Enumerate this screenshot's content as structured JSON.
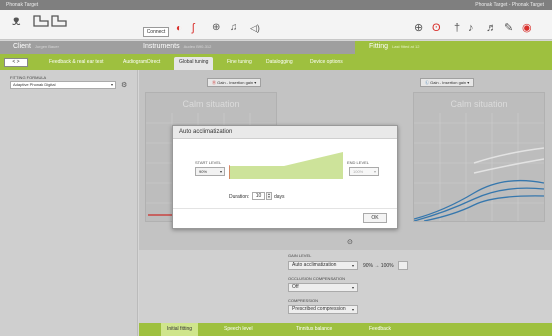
{
  "titlebar": {
    "app_name": "Phonak Target",
    "right_text": "Phonak Target - Phonak Target"
  },
  "toolbar": {
    "connect_label": "Connect",
    "icons": [
      "person-icon",
      "hearing-aids-icon",
      "ear-icon",
      "mic-icon",
      "speaker-icon",
      "globe-icon",
      "music-icon",
      "flag-icon",
      "dummy-icon",
      "tools-icon",
      "remote-icon"
    ]
  },
  "infobar": {
    "client_label": "Client",
    "client_sub": "Jurgen Bauer",
    "instruments_label": "Instruments",
    "instruments_sub": "Audeo B90-312",
    "fitting_label": "Fitting",
    "fitting_sub": "Last fitted at 12"
  },
  "tabs": {
    "nav_label": "< >",
    "items": [
      "Feedback & real ear test",
      "AudiogramDirect",
      "Global tuning",
      "Fine tuning",
      "Datalogging",
      "Device options"
    ],
    "active_index": 2
  },
  "left_panel": {
    "formula_label": "FITTING FORMULA",
    "formula_value": "Adaptive Phonak Digital"
  },
  "main": {
    "gain_left": "Gain - Insertion gain",
    "gain_right": "Gain - Insertion gain",
    "chart_title_left": "Calm situation",
    "chart_title_right": "Calm situation"
  },
  "settings": {
    "gain_level_label": "GAIN LEVEL",
    "gain_level_value": "Auto acclimatization",
    "gain_level_range": "90% → 100%",
    "occlusion_label": "OCCLUSION COMPENSATION",
    "occlusion_value": "Off",
    "compression_label": "COMPRESSION",
    "compression_value": "Prescribed compression"
  },
  "bottom_tabs": [
    "Initial fitting",
    "Speech level",
    "Tinnitus balance",
    "Feedback"
  ],
  "dialog": {
    "title": "Auto acclimatization",
    "start_label": "START LEVEL",
    "start_value": "90%",
    "end_label": "END LEVEL",
    "end_value": "100%",
    "duration_label": "Duration:",
    "duration_value": "10",
    "days_label": "days",
    "ok_label": "OK"
  },
  "colors": {
    "accent_green": "#9ec03f",
    "ramp_green": "#cde39a",
    "red": "#d9302c",
    "blue": "#3a7fb8"
  }
}
